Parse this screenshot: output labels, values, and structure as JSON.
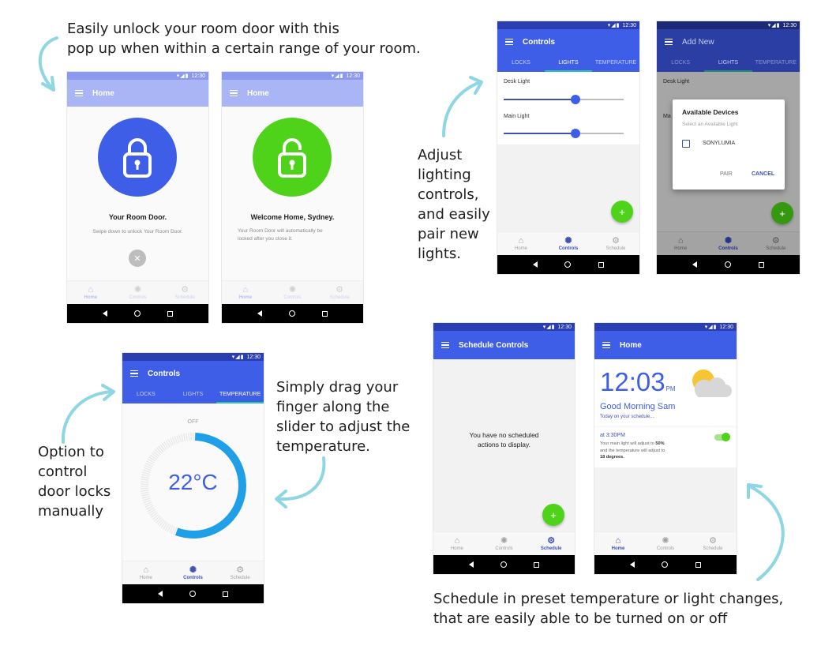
{
  "colors": {
    "primary": "#3f51b5",
    "appbar": "#3f5ee8",
    "statusbar": "#2a3eb1",
    "faded_appbar": "#a9b5f5",
    "lock_blue": "#3f5ee8",
    "unlock_green": "#4fd31a",
    "accent_green": "#4fd31a",
    "temp_ring": "#1e9fe8",
    "caption_arrow": "#8ed6e3"
  },
  "captions": {
    "unlock": "Easily unlock your room door with this\npop up when within a certain range of your room.",
    "lighting": "Adjust\nlighting\ncontrols,\nand easily\npair new\nlights.",
    "locks": "Option to\ncontrol\ndoor locks\nmanually",
    "drag": "Simply drag your\nfinger along the\nslider to adjust the\ntemperature.",
    "schedule": "Schedule in preset temperature or light changes,\nthat are easily  able to be turned on or off"
  },
  "status": {
    "time": "12:30",
    "icons": "▾◢▮"
  },
  "bottom_nav": [
    {
      "label": "Home",
      "icon": "home-icon",
      "glyph": "⌂"
    },
    {
      "label": "Controls",
      "icon": "sun-gear-icon",
      "glyph": "✺"
    },
    {
      "label": "Schedule",
      "icon": "cog-icon",
      "glyph": "⚙"
    }
  ],
  "system_nav": {
    "back": "◁",
    "home": "○",
    "recent": "□"
  },
  "screen_lock": {
    "title": "Home",
    "heading": "Your Room Door.",
    "subtitle": "Swipe down to unlock Your Room Door.",
    "dismiss_glyph": "✕"
  },
  "screen_unlocked": {
    "title": "Home",
    "heading": "Welcome Home, Sydney.",
    "subtitle": "Your Room Door will automatically be\nlocked after you close it."
  },
  "screen_controls_lights": {
    "title": "Controls",
    "tabs": [
      "LOCKS",
      "LIGHTS",
      "TEMPERATURE"
    ],
    "active_tab": "LIGHTS",
    "sliders": [
      {
        "label": "Desk Light",
        "value": 0.6
      },
      {
        "label": "Main Light",
        "value": 0.6
      }
    ],
    "fab": "+"
  },
  "screen_add_new": {
    "title": "Add New",
    "tabs": [
      "LOCKS",
      "LIGHTS",
      "TEMPERATURE"
    ],
    "bg_label_1": "Desk Light",
    "bg_label_2": "Ma",
    "dialog": {
      "title": "Available Devices",
      "subtitle": "Select an Available Light",
      "device": "SONYLUMIA",
      "pair": "PAIR",
      "cancel": "CANCEL"
    },
    "fab": "+"
  },
  "screen_temperature": {
    "title": "Controls",
    "tabs": [
      "LOCKS",
      "LIGHTS",
      "TEMPERATURE"
    ],
    "active_tab": "TEMPERATURE",
    "off_label": "OFF",
    "temperature": "22°C",
    "dial_fraction": 0.55
  },
  "screen_schedule": {
    "title": "Schedule Controls",
    "empty_message": "You have no scheduled\nactions to display.",
    "fab": "+"
  },
  "screen_home": {
    "title": "Home",
    "clock": "12:03",
    "ampm": "PM",
    "greeting": "Good Morning Sam",
    "schedule_link": "Today on your schedule...",
    "event_time": "at 3:30PM",
    "event_text_1": "Your main light will adjust to ",
    "event_bold_1": "50%",
    "event_text_2": "and the temperature will adjust to",
    "event_bold_2": "18 degrees.",
    "toggle_on": true
  }
}
